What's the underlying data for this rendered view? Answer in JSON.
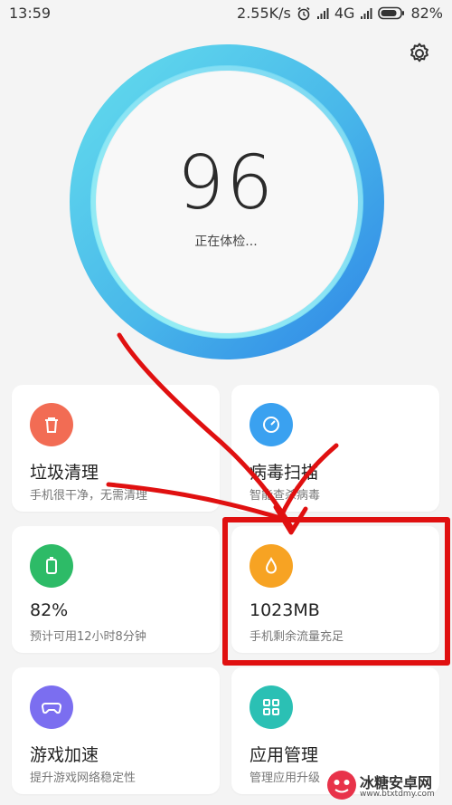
{
  "status_bar": {
    "time": "13:59",
    "speed": "2.55K/s",
    "network": "4G",
    "battery": "82%"
  },
  "header": {
    "settings_icon": "gear-icon"
  },
  "gauge": {
    "score": "96",
    "status": "正在体检..."
  },
  "cards": [
    {
      "title": "垃圾清理",
      "subtitle": "手机很干净，无需清理",
      "icon": "trash-icon",
      "color": "#f26c54"
    },
    {
      "title": "病毒扫描",
      "subtitle": "智能查杀病毒",
      "icon": "speedometer-icon",
      "color": "#3aa1f0"
    },
    {
      "title": "82%",
      "subtitle": "预计可用12小时8分钟",
      "icon": "battery-icon",
      "color": "#2dbb67"
    },
    {
      "title": "1023MB",
      "subtitle": "手机剩余流量充足",
      "icon": "drop-icon",
      "color": "#f7a323"
    },
    {
      "title": "游戏加速",
      "subtitle": "提升游戏网络稳定性",
      "icon": "gamepad-icon",
      "color": "#7b6ef0"
    },
    {
      "title": "应用管理",
      "subtitle": "管理应用升级",
      "icon": "apps-grid-icon",
      "color": "#2bc0b4"
    }
  ],
  "watermark": {
    "name": "冰糖安卓网",
    "url": "www.btxtdmy.com"
  },
  "colors": {
    "highlight": "#e01010",
    "gauge_start": "#5fd9ec",
    "gauge_end": "#2f86e6"
  }
}
